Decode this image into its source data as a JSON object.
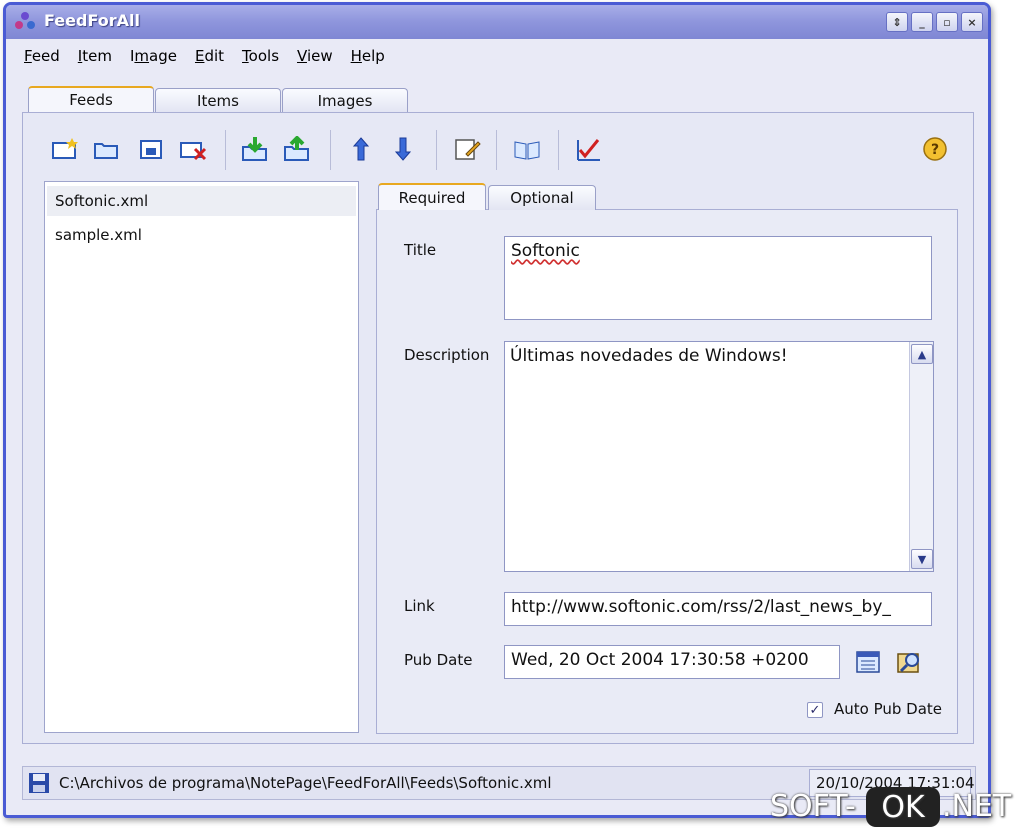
{
  "window": {
    "title": "FeedForAll"
  },
  "titlebar_buttons": [
    "⇕",
    "_",
    "▫",
    "×"
  ],
  "menu": [
    {
      "pre": "",
      "u": "F",
      "post": "eed"
    },
    {
      "pre": "",
      "u": "I",
      "post": "tem"
    },
    {
      "pre": "I",
      "u": "m",
      "post": "age"
    },
    {
      "pre": "",
      "u": "E",
      "post": "dit"
    },
    {
      "pre": "",
      "u": "T",
      "post": "ools"
    },
    {
      "pre": "",
      "u": "V",
      "post": "iew"
    },
    {
      "pre": "",
      "u": "H",
      "post": "elp"
    }
  ],
  "tabs": [
    "Feeds",
    "Items",
    "Images"
  ],
  "files": [
    "Softonic.xml",
    "sample.xml"
  ],
  "inner_tabs": [
    "Required",
    "Optional"
  ],
  "form": {
    "title_label": "Title",
    "title_value": "Softonic",
    "description_label": "Description",
    "description_value": "Últimas novedades de Windows!",
    "link_label": "Link",
    "link_value": "http://www.softonic.com/rss/2/last_news_by_",
    "pubdate_label": "Pub Date",
    "pubdate_value": "Wed, 20 Oct 2004 17:30:58 +0200",
    "auto_pubdate_label": "Auto Pub Date",
    "auto_pubdate_checked": true
  },
  "status": {
    "path": "C:\\Archivos de programa\\NotePage\\FeedForAll\\Feeds\\Softonic.xml",
    "time": "20/10/2004 17:31:04"
  },
  "watermark": {
    "left": "SOFT-",
    "mid": "OK",
    "right": ".NET"
  },
  "colors": {
    "frame": "#4a5bd4",
    "tab_accent": "#e8a820"
  }
}
